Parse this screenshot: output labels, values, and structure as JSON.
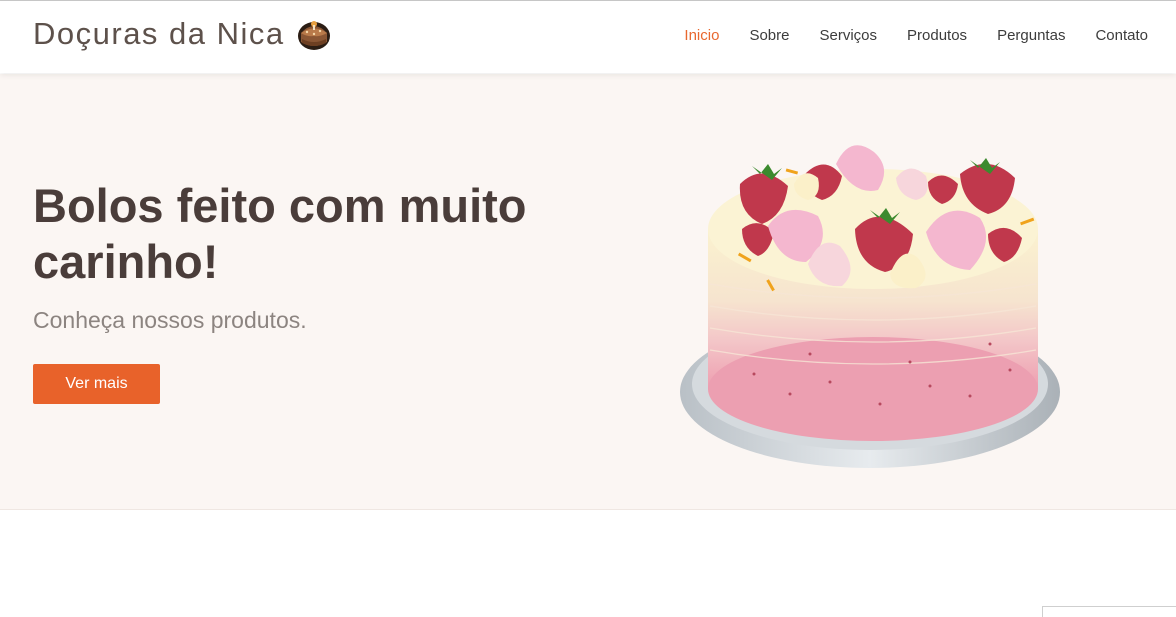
{
  "header": {
    "brand": "Doçuras da Nica",
    "brand_icon": "cake-icon",
    "nav": [
      {
        "label": "Inicio",
        "active": true
      },
      {
        "label": "Sobre",
        "active": false
      },
      {
        "label": "Serviços",
        "active": false
      },
      {
        "label": "Produtos",
        "active": false
      },
      {
        "label": "Perguntas",
        "active": false
      },
      {
        "label": "Contato",
        "active": false
      }
    ]
  },
  "hero": {
    "title": "Bolos feito com muito carinho!",
    "subtitle": "Conheça nossos produtos.",
    "button_label": "Ver mais",
    "image": "strawberry-layer-cake-image"
  },
  "colors": {
    "accent": "#e8622a",
    "nav_active": "#e8682f",
    "hero_background": "#fbf6f3",
    "heading": "#4a3d3a"
  }
}
